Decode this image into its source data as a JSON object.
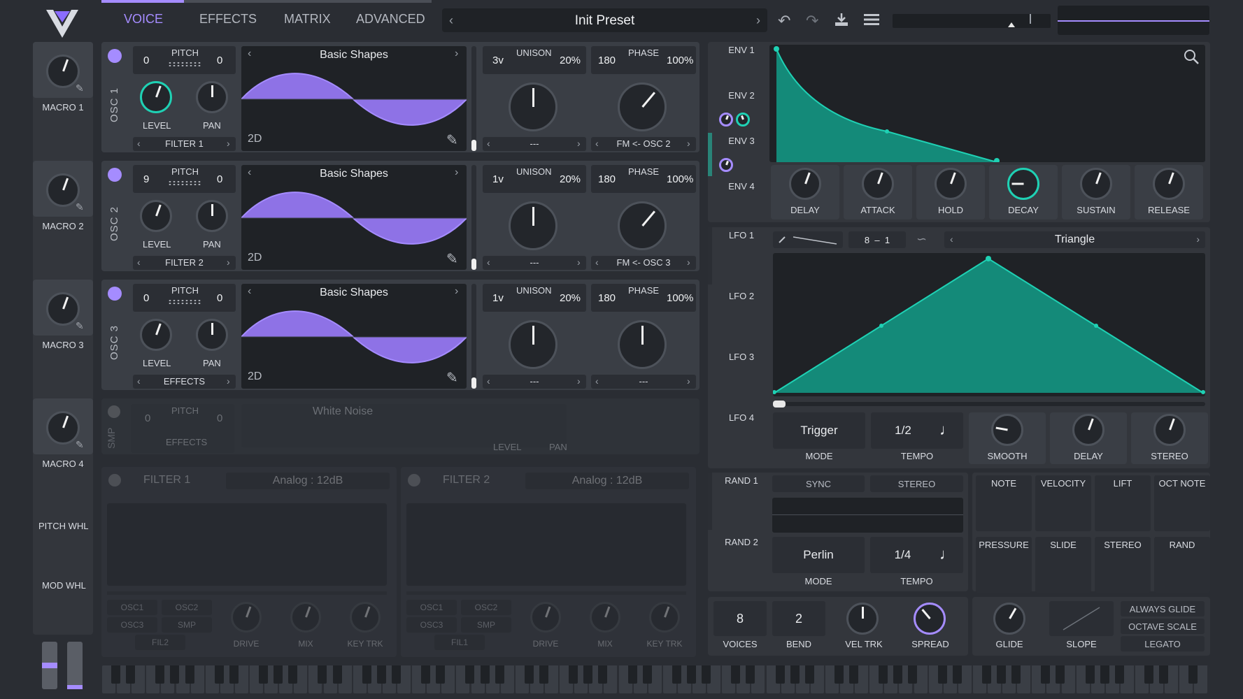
{
  "header": {
    "tabs": [
      "VOICE",
      "EFFECTS",
      "MATRIX",
      "ADVANCED"
    ],
    "active_tab": "VOICE",
    "preset": "Init Preset"
  },
  "macros": [
    "MACRO 1",
    "MACRO 2",
    "MACRO 3",
    "MACRO 4"
  ],
  "wheels": [
    "PITCH WHL",
    "MOD WHL"
  ],
  "osc": [
    {
      "name": "OSC 1",
      "pitch_label": "PITCH",
      "pitch_left": "0",
      "pitch_right": "0",
      "level": "LEVEL",
      "pan": "PAN",
      "dest": "FILTER 1",
      "wavetable": "Basic Shapes",
      "dim": "2D",
      "unison_voices": "3v",
      "unison_label": "UNISON",
      "unison_pct": "20%",
      "phase_val": "180",
      "phase_label": "PHASE",
      "phase_pct": "100%",
      "left_sel": "---",
      "right_sel": "FM <- OSC 2"
    },
    {
      "name": "OSC 2",
      "pitch_label": "PITCH",
      "pitch_left": "9",
      "pitch_right": "0",
      "level": "LEVEL",
      "pan": "PAN",
      "dest": "FILTER 2",
      "wavetable": "Basic Shapes",
      "dim": "2D",
      "unison_voices": "1v",
      "unison_label": "UNISON",
      "unison_pct": "20%",
      "phase_val": "180",
      "phase_label": "PHASE",
      "phase_pct": "100%",
      "left_sel": "---",
      "right_sel": "FM <- OSC 3"
    },
    {
      "name": "OSC 3",
      "pitch_label": "PITCH",
      "pitch_left": "0",
      "pitch_right": "0",
      "level": "LEVEL",
      "pan": "PAN",
      "dest": "EFFECTS",
      "wavetable": "Basic Shapes",
      "dim": "2D",
      "unison_voices": "1v",
      "unison_label": "UNISON",
      "unison_pct": "20%",
      "phase_val": "180",
      "phase_label": "PHASE",
      "phase_pct": "100%",
      "left_sel": "---",
      "right_sel": "---"
    }
  ],
  "smp": {
    "name": "SMP",
    "pitch_label": "PITCH",
    "pitch_left": "0",
    "pitch_right": "0",
    "sample": "White Noise",
    "dest": "EFFECTS",
    "level": "LEVEL",
    "pan": "PAN"
  },
  "filters": [
    {
      "name": "FILTER 1",
      "type": "Analog : 12dB",
      "src": [
        "OSC1",
        "OSC2",
        "OSC3",
        "SMP",
        "FIL2"
      ],
      "drive": "DRIVE",
      "mix": "MIX",
      "keytrk": "KEY TRK"
    },
    {
      "name": "FILTER 2",
      "type": "Analog : 12dB",
      "src": [
        "OSC1",
        "OSC2",
        "OSC3",
        "SMP",
        "FIL1"
      ],
      "drive": "DRIVE",
      "mix": "MIX",
      "keytrk": "KEY TRK"
    }
  ],
  "env": {
    "tabs": [
      "ENV 1",
      "ENV 2",
      "ENV 3",
      "ENV 4"
    ],
    "knobs": [
      "DELAY",
      "ATTACK",
      "HOLD",
      "DECAY",
      "SUSTAIN",
      "RELEASE"
    ]
  },
  "lfo": {
    "tabs": [
      "LFO 1",
      "LFO 2",
      "LFO 3",
      "LFO 4"
    ],
    "grid_x": "8",
    "grid_y": "1",
    "shape": "Triangle",
    "mode_val": "Trigger",
    "mode_label": "MODE",
    "tempo_val": "1/2",
    "tempo_label": "TEMPO",
    "knobs": [
      "SMOOTH",
      "DELAY",
      "STEREO"
    ]
  },
  "rand": {
    "tabs": [
      "RAND 1",
      "RAND 2"
    ],
    "sync": "SYNC",
    "stereo": "STEREO",
    "mode_val": "Perlin",
    "mode_label": "MODE",
    "tempo_val": "1/4",
    "tempo_label": "TEMPO"
  },
  "mod_sources": [
    [
      "NOTE",
      "VELOCITY",
      "LIFT",
      "OCT NOTE"
    ],
    [
      "PRESSURE",
      "SLIDE",
      "STEREO",
      "RAND"
    ]
  ],
  "voice": {
    "voices_val": "8",
    "voices": "VOICES",
    "bend_val": "2",
    "bend": "BEND",
    "veltrk": "VEL TRK",
    "spread": "SPREAD",
    "glide": "GLIDE",
    "slope": "SLOPE",
    "always_glide": "ALWAYS GLIDE",
    "octave_scale": "OCTAVE SCALE",
    "legato": "LEGATO"
  },
  "colors": {
    "accent": "#a58cff",
    "env": "#1fd1b4",
    "bg": "#2a2d33",
    "panel": "#3a3e45"
  }
}
